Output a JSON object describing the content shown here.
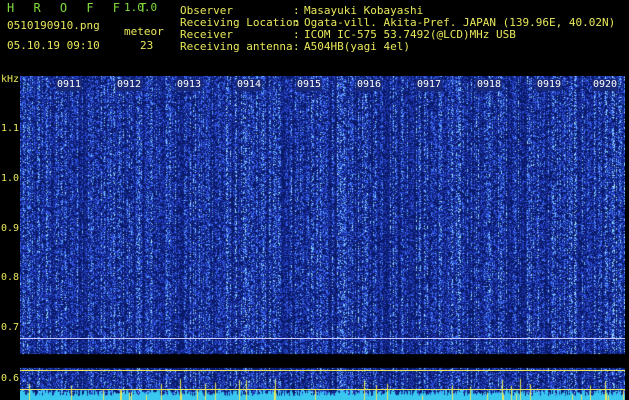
{
  "app": {
    "title": "H R O F F T",
    "version": "1.0.0"
  },
  "header": {
    "filename": "0510190910.png",
    "datetime": "05.10.19 09:10",
    "meteor_label": "meteor",
    "meteor_count": "23"
  },
  "info": [
    {
      "label": "Observer",
      "value": "Masayuki Kobayashi"
    },
    {
      "label": "Receiving Location",
      "value": "Ogata-vill. Akita-Pref. JAPAN (139.96E, 40.02N)"
    },
    {
      "label": "Receiver",
      "value": "ICOM IC-575 53.7492(@LCD)MHz USB"
    },
    {
      "label": "Receiving antenna",
      "value": "A504HB(yagi 4el)"
    }
  ],
  "y_axis": {
    "unit": "kHz",
    "ticks": [
      "1.1",
      "1.0",
      "0.9",
      "0.8",
      "0.7",
      "0.6"
    ]
  },
  "time_marks": [
    "0911",
    "0912",
    "0913",
    "0914",
    "0915",
    "0916",
    "0917",
    "0918",
    "0919",
    "0920"
  ],
  "colors": {
    "header_green": "#7fdc3c",
    "header_yellow": "#e8e85a",
    "spectrogram_base": "#0a1a6b",
    "spectrogram_noise": "#3c6cff",
    "baseline_line": "#c8c8ff",
    "floor_band": "#38c8f0",
    "meteor_spike": "#e8e85a"
  }
}
